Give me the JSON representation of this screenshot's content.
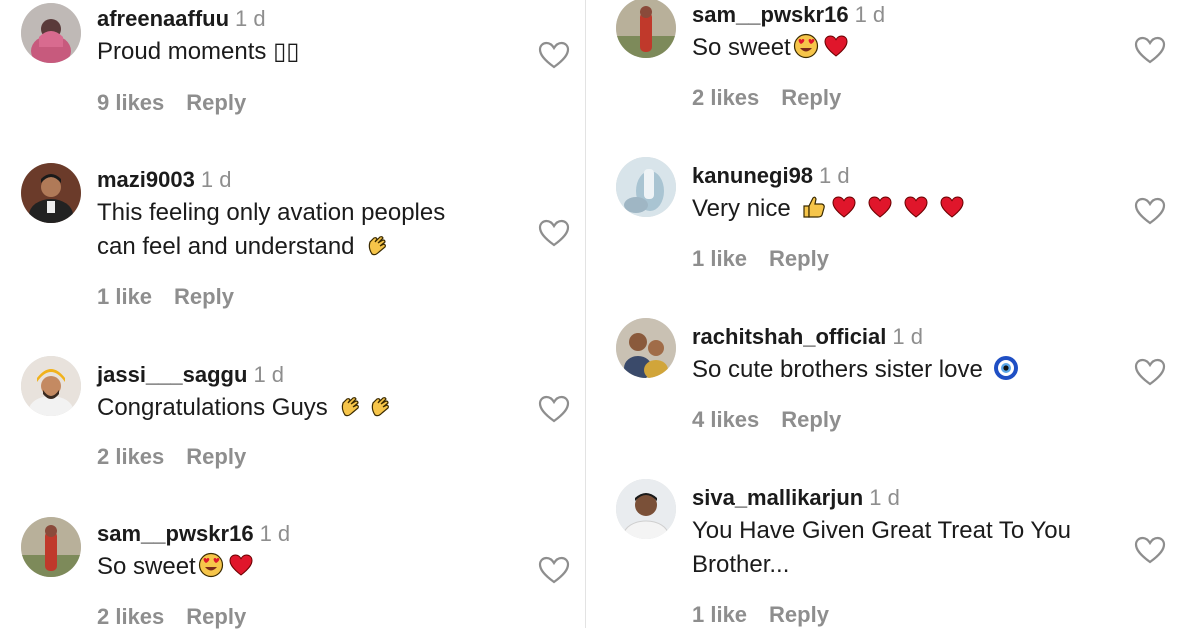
{
  "left_comments": [
    {
      "username": "afreenaaffuu",
      "time": "1 d",
      "text": "Proud moments ▯▯",
      "emojis": [],
      "likes": "9 likes",
      "reply": "Reply",
      "avatar": "person-in-pink-avatar"
    },
    {
      "username": "mazi9003",
      "time": "1 d",
      "line1": "This feeling only avation peoples",
      "line2": "can feel and understand",
      "emojis": [
        "clapping-hands-icon"
      ],
      "likes": "1 like",
      "reply": "Reply",
      "avatar": "man-in-suit-avatar"
    },
    {
      "username": "jassi___saggu",
      "time": "1 d",
      "text": "Congratulations Guys",
      "emojis": [
        "clapping-hands-icon",
        "clapping-hands-icon"
      ],
      "likes": "2 likes",
      "reply": "Reply",
      "avatar": "man-in-turban-avatar"
    },
    {
      "username": "sam__pwskr16",
      "time": "1 d",
      "text": "So sweet",
      "emojis": [
        "heart-eyes-face-icon",
        "red-heart-icon"
      ],
      "likes": "2 likes",
      "reply": "Reply",
      "avatar": "person-in-red-avatar"
    }
  ],
  "right_comments": [
    {
      "username": "sam__pwskr16",
      "time": "1 d",
      "text": "So sweet",
      "emojis": [
        "heart-eyes-face-icon",
        "red-heart-icon"
      ],
      "likes": "2 likes",
      "reply": "Reply",
      "avatar": "person-in-red-avatar"
    },
    {
      "username": "kanunegi98",
      "time": "1 d",
      "text": "Very nice",
      "emojis": [
        "thumbs-up-icon",
        "red-heart-icon",
        "red-heart-icon",
        "red-heart-icon",
        "red-heart-icon"
      ],
      "likes": "1 like",
      "reply": "Reply",
      "avatar": "light-photo-avatar"
    },
    {
      "username": "rachitshah_official",
      "time": "1 d",
      "text": "So cute brothers sister love",
      "emojis": [
        "nazar-amulet-icon"
      ],
      "likes": "4 likes",
      "reply": "Reply",
      "avatar": "two-people-avatar"
    },
    {
      "username": "siva_mallikarjun",
      "time": "1 d",
      "line1": "You Have Given Great Treat To You",
      "line2": "Brother...",
      "emojis": [],
      "likes": "1 like",
      "reply": "Reply",
      "avatar": "man-portrait-avatar"
    }
  ],
  "colors": {
    "username": "#1b1b1b",
    "muted": "#8e8e8e",
    "heart_outline": "#8e8e8e",
    "emoji_heart": "#e0162b",
    "emoji_yellow": "#f6c54a"
  }
}
